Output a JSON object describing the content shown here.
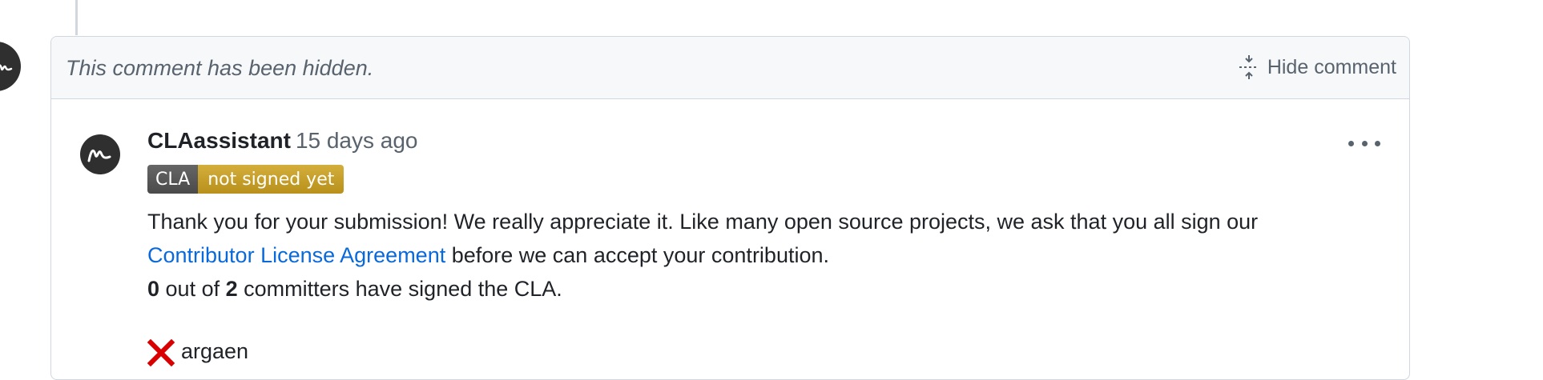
{
  "hidden_comment": {
    "notice": "This comment has been hidden.",
    "hide_label": "Hide comment"
  },
  "comment": {
    "author": "CLAassistant",
    "timestamp": "15 days ago",
    "badge": {
      "left": "CLA",
      "right": "not signed yet"
    },
    "body": {
      "line1": "Thank you for your submission! We really appreciate it. Like many open source projects, we ask that you all sign our",
      "link_text": "Contributor License Agreement",
      "line2_rest": " before we can accept your contribution.",
      "signed_count": "0",
      "out_of": " out of ",
      "total_count": "2",
      "committers_text": " committers have signed the CLA."
    },
    "signers": [
      {
        "name": "argaen",
        "status": "not-signed",
        "icon": "red-x-icon"
      }
    ]
  },
  "colors": {
    "link": "#0969da",
    "badge_left": "#555555",
    "badge_right": "#c9a229",
    "cross": "#d80000"
  }
}
